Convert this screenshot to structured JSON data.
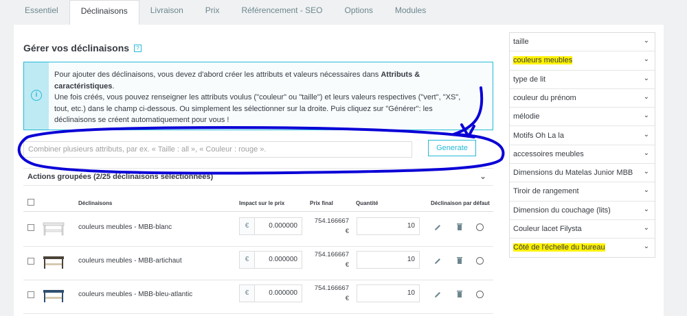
{
  "tabs": [
    {
      "label": "Essentiel"
    },
    {
      "label": "Déclinaisons"
    },
    {
      "label": "Livraison"
    },
    {
      "label": "Prix"
    },
    {
      "label": "Référencement - SEO"
    },
    {
      "label": "Options"
    },
    {
      "label": "Modules"
    }
  ],
  "section": {
    "title": "Gérer vos déclinaisons",
    "help_glyph": "?"
  },
  "info": {
    "icon": "info-icon",
    "text_1": "Pour ajouter des déclinaisons, vous devez d'abord créer les attributs et valeurs nécessaires dans ",
    "text_bold": "Attributs & caractéristiques",
    "text_2": ".",
    "text_3": "Une fois créés, vous pouvez renseigner les attributs voulus (\"couleur\" ou \"taille\") et leurs valeurs respectives (\"vert\", \"XS\", tout, etc.) dans le champ ci-dessous. Ou simplement les sélectionner sur la droite. Puis cliquez sur \"Générer\": les déclinaisons se créent automatiquement pour vous !"
  },
  "combine": {
    "placeholder": "Combiner plusieurs attributs, par ex. « Taille : all », « Couleur : rouge ».",
    "generate_label": "Generate"
  },
  "bulk": {
    "label": "Actions groupées (2/25 déclinaisons sélectionnées)"
  },
  "table": {
    "headers": {
      "declinaisons": "Déclinaisons",
      "impact": "Impact sur le prix",
      "price": "Prix final",
      "qty": "Quantité",
      "default": "Déclinaison par défaut"
    },
    "rows": [
      {
        "name": "couleurs meubles - MBB-blanc",
        "currency": "€",
        "impact": "0.000000",
        "price": "754.166667",
        "price_cur": "€",
        "qty": "10",
        "thumb_color": "#e8e8e8"
      },
      {
        "name": "couleurs meubles - MBB-artichaut",
        "currency": "€",
        "impact": "0.000000",
        "price": "754.166667",
        "price_cur": "€",
        "qty": "10",
        "thumb_color": "#4a4238"
      },
      {
        "name": "couleurs meubles - MBB-bleu-atlantic",
        "currency": "€",
        "impact": "0.000000",
        "price": "754.166667",
        "price_cur": "€",
        "qty": "10",
        "thumb_color": "#2f4f6f"
      }
    ]
  },
  "attributes": [
    {
      "label": "taille",
      "highlight": false
    },
    {
      "label": "couleurs meubles",
      "highlight": true
    },
    {
      "label": "type de lit",
      "highlight": false
    },
    {
      "label": "couleur du prénom",
      "highlight": false
    },
    {
      "label": "mélodie",
      "highlight": false
    },
    {
      "label": "Motifs Oh La la",
      "highlight": false
    },
    {
      "label": "accessoires meubles",
      "highlight": false
    },
    {
      "label": "Dimensions du Matelas Junior MBB",
      "highlight": false
    },
    {
      "label": "Tiroir de rangement",
      "highlight": false
    },
    {
      "label": "Dimension du couchage (lits)",
      "highlight": false
    },
    {
      "label": "Couleur lacet Filysta",
      "highlight": false
    },
    {
      "label": "Côté de l'échelle du bureau",
      "highlight": true
    }
  ],
  "colors": {
    "accent": "#25b9d7",
    "highlight": "#fff200",
    "annotation": "#0a00d6"
  }
}
